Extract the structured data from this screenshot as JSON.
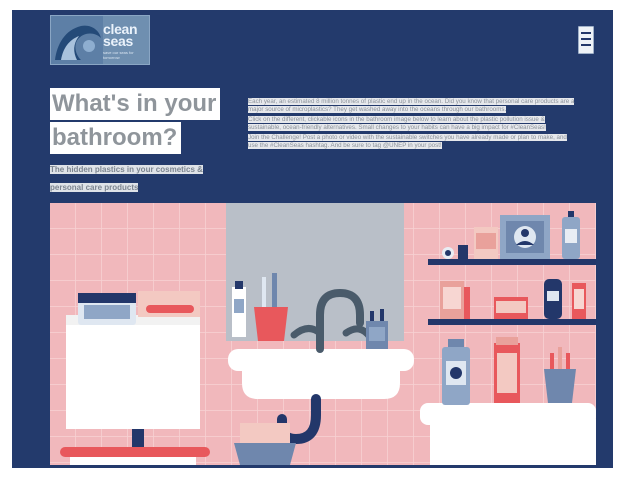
{
  "brand": {
    "name_line1": "clean",
    "name_line2": "seas",
    "tagline": "save our seas for tomorrow"
  },
  "header": {
    "menu_icon": "hamburger-menu-icon"
  },
  "hero": {
    "title_line1": "What's in your",
    "title_line2": "bathroom?",
    "subtitle": "The hidden plastics in your cosmetics & personal care products",
    "paragraphs": [
      "Each year, an estimated 8 million tonnes of plastic end up in the ocean. Did you know that personal care products are a major source of microplastics? They get washed away into the oceans through our bathrooms.",
      "Click on the different, clickable icons in the bathroom image below to learn about the plastic pollution issue & sustainable, ocean-friendly alternatives. Small changes to your habits can have a big impact for #CleanSeas!",
      "Join the Challenge! Post a photo or video with the sustainable switches you have already made or plan to make, and use the #CleanSeas hashtag. And be sure to tag @UNEP in your post!"
    ]
  },
  "colors": {
    "page_bg": "#233a6c",
    "wall_tile": "#f1b8bc",
    "sink": "#ffffff",
    "pipe": "#23376a",
    "accent_red": "#e8585c"
  },
  "bathroom_items": [
    "cabinet-toiletry-bag",
    "soap-dish",
    "toothbrush-cup",
    "toothpaste-tube",
    "faucet",
    "soap-dispenser",
    "mirror",
    "drain-pipe",
    "laundry-basket",
    "shelf-skincare-box",
    "shelf-pump-bottle",
    "shelf-jar",
    "shelf-cosmetics",
    "shampoo-bottle",
    "cotton-swab-box",
    "brush-cup",
    "bathtub"
  ]
}
